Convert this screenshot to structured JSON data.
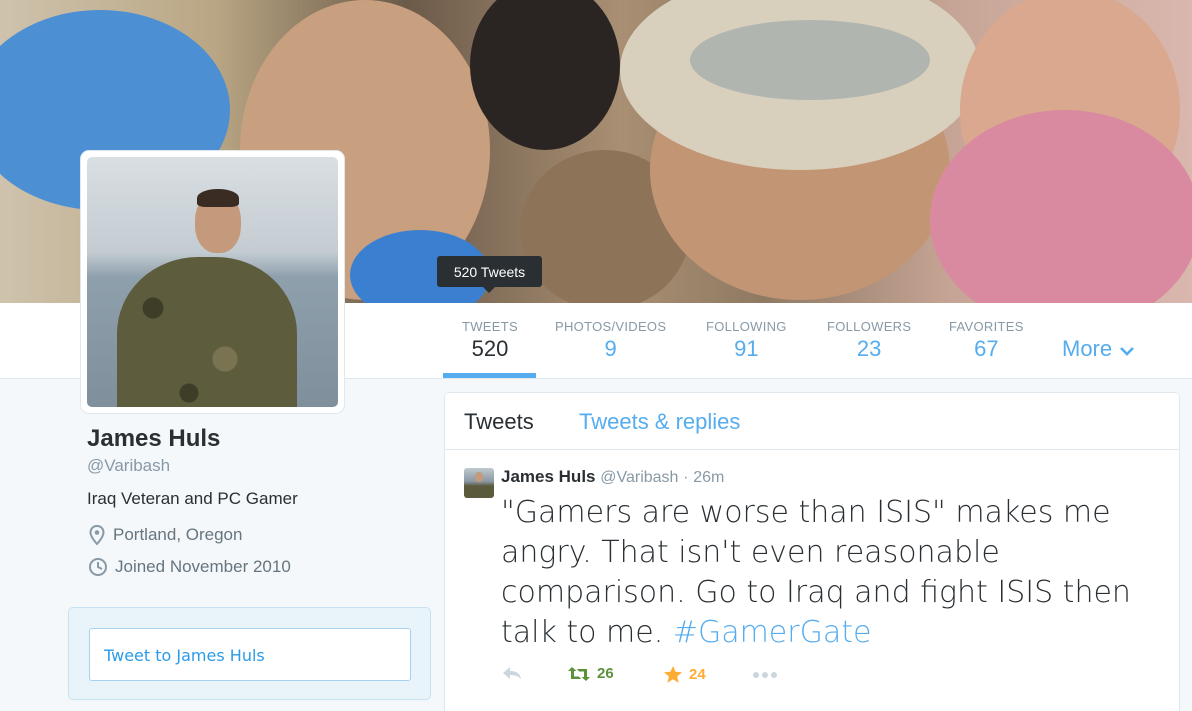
{
  "tooltip": {
    "text": "520 Tweets"
  },
  "nav": {
    "stats": [
      {
        "label": "TWEETS",
        "value": "520"
      },
      {
        "label": "PHOTOS/VIDEOS",
        "value": "9"
      },
      {
        "label": "FOLLOWING",
        "value": "91"
      },
      {
        "label": "FOLLOWERS",
        "value": "23"
      },
      {
        "label": "FAVORITES",
        "value": "67"
      }
    ],
    "more_label": "More"
  },
  "profile": {
    "name": "James Huls",
    "handle": "@Varibash",
    "bio": "Iraq Veteran and PC Gamer",
    "location": "Portland, Oregon",
    "joined": "Joined November 2010"
  },
  "tweet_to": {
    "placeholder": "Tweet to James Huls"
  },
  "timeline": {
    "tabs": [
      "Tweets",
      "Tweets & replies"
    ],
    "tweets": [
      {
        "name": "James Huls",
        "handle": "@Varibash",
        "separator": "·",
        "time": "26m",
        "text": "\"Gamers are worse than ISIS\" makes me angry. That isn't even reasonable comparison. Go to Iraq and fight ISIS then talk to me.",
        "hashtag": "#GamerGate",
        "retweets": "26",
        "favorites": "24"
      }
    ]
  },
  "colors": {
    "accent": "#55acee",
    "retweet": "#5c913b",
    "favorite": "#ffac33",
    "muted": "#8899a6"
  }
}
